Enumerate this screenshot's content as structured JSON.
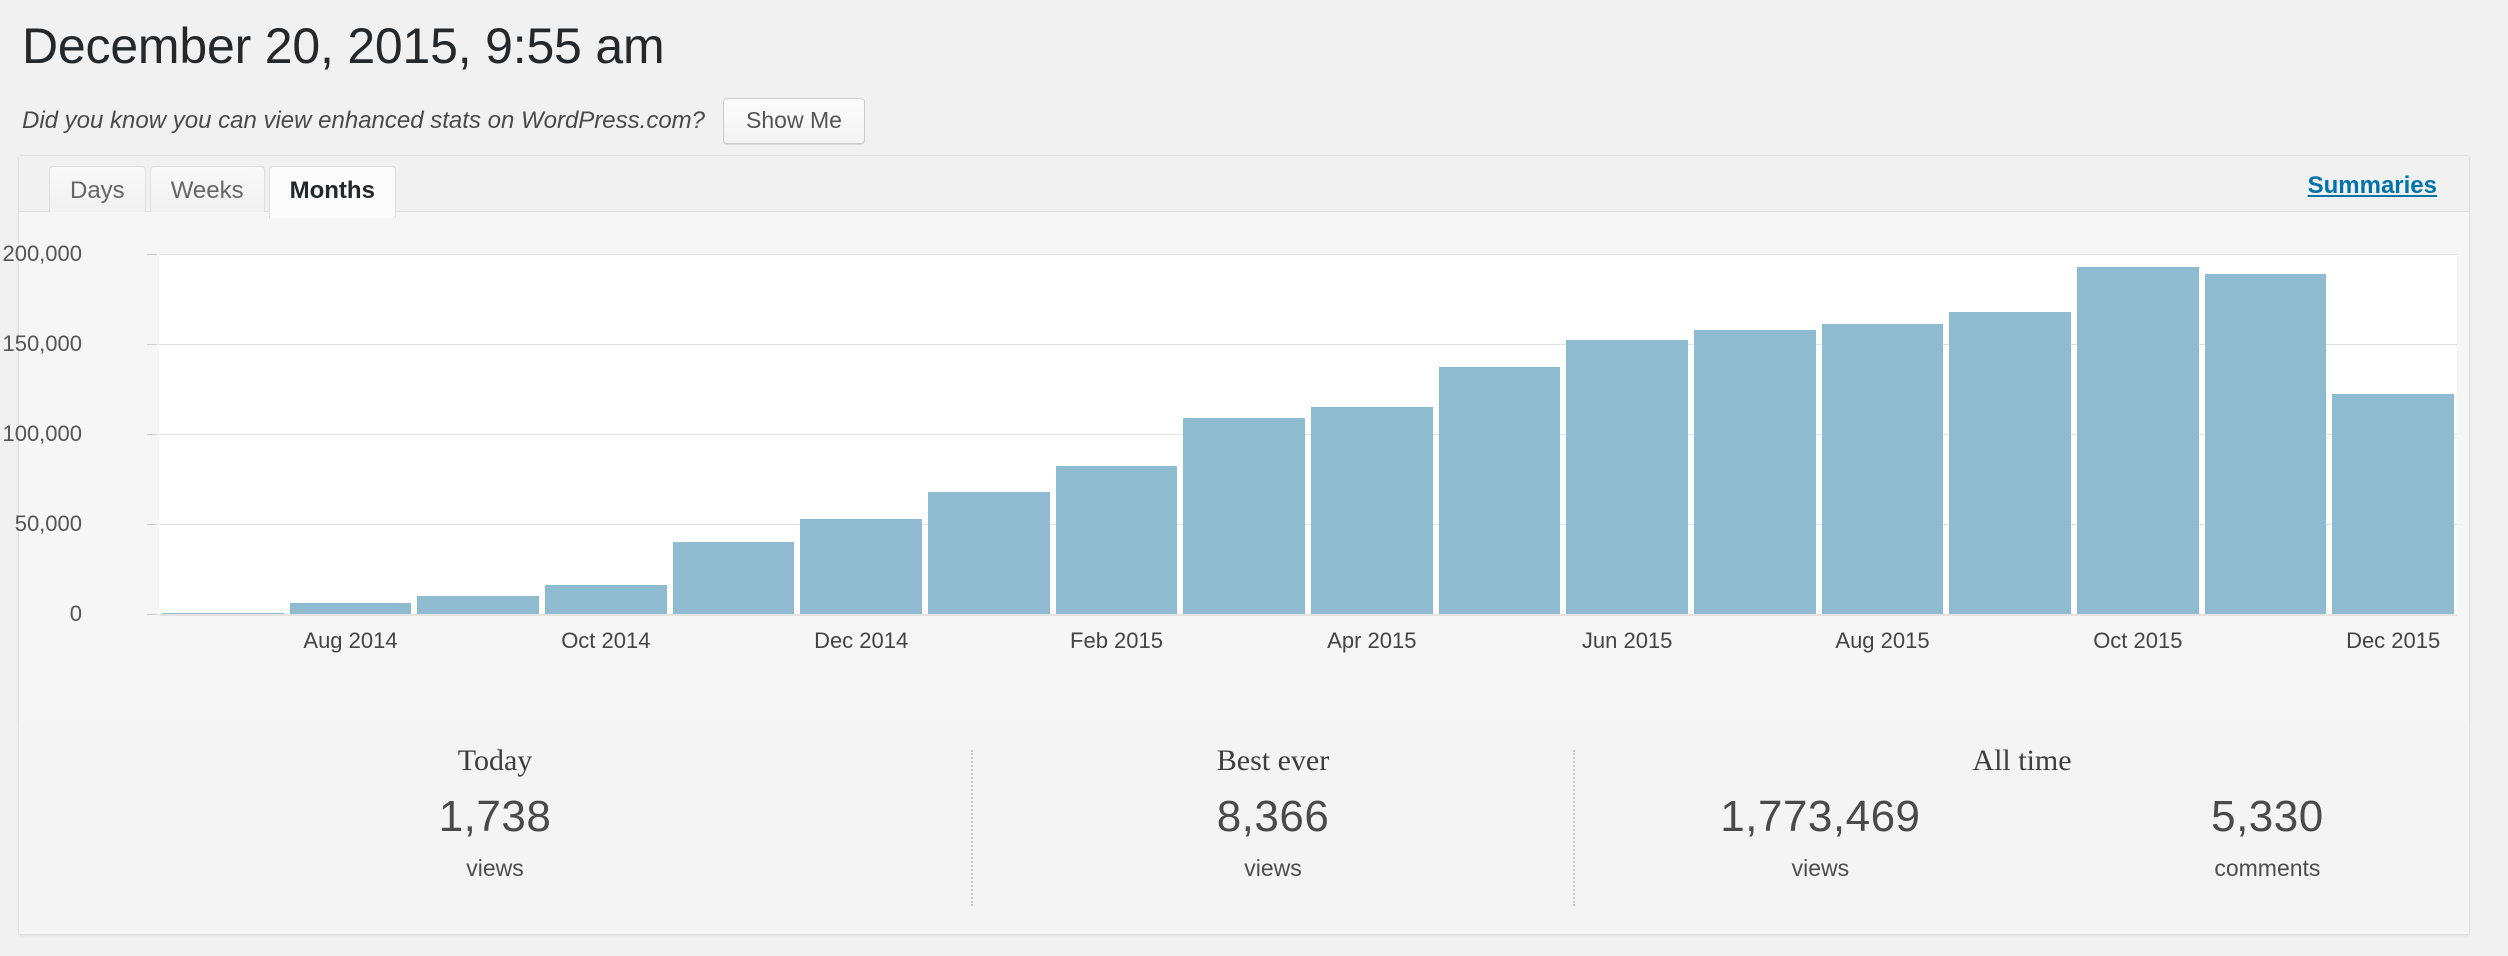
{
  "header": {
    "title": "December 20, 2015, 9:55 am",
    "promo_text": "Did you know you can view enhanced stats on WordPress.com?",
    "show_me_label": "Show Me"
  },
  "tabs": [
    {
      "label": "Days",
      "active": false
    },
    {
      "label": "Weeks",
      "active": false
    },
    {
      "label": "Months",
      "active": true
    }
  ],
  "summaries_link": "Summaries",
  "chart_data": {
    "type": "bar",
    "title": "",
    "xlabel": "",
    "ylabel": "",
    "ylim": [
      0,
      200000
    ],
    "grid": true,
    "legend": "none",
    "bar_color": "#8fbbd0",
    "ytick_labels": [
      "200,000",
      "150,000",
      "100,000",
      "50,000",
      "0"
    ],
    "ytick_values": [
      200000,
      150000,
      100000,
      50000,
      0
    ],
    "categories": [
      "Jul 2014",
      "Aug 2014",
      "Sep 2014",
      "Oct 2014",
      "Nov 2014",
      "Dec 2014",
      "Jan 2015",
      "Feb 2015",
      "Mar 2015",
      "Apr 2015",
      "May 2015",
      "Jun 2015",
      "Jul 2015",
      "Aug 2015",
      "Sep 2015",
      "Oct 2015",
      "Nov 2015",
      "Dec 2015"
    ],
    "values": [
      500,
      6000,
      10000,
      16000,
      40000,
      53000,
      68000,
      82000,
      109000,
      115000,
      137000,
      152000,
      158000,
      161000,
      168000,
      193000,
      189000,
      122000
    ],
    "visible_xtick_labels": [
      "Aug 2014",
      "Oct 2014",
      "Dec 2014",
      "Feb 2015",
      "Apr 2015",
      "Jun 2015",
      "Aug 2015",
      "Oct 2015",
      "Dec 2015"
    ],
    "visible_xtick_indices": [
      1,
      3,
      5,
      7,
      9,
      11,
      13,
      15,
      17
    ]
  },
  "summary": {
    "today": {
      "title": "Today",
      "value": "1,738",
      "unit": "views"
    },
    "best_ever": {
      "title": "Best ever",
      "value": "8,366",
      "unit": "views"
    },
    "all_time": {
      "title": "All time",
      "views_value": "1,773,469",
      "views_unit": "views",
      "comments_value": "5,330",
      "comments_unit": "comments"
    }
  }
}
